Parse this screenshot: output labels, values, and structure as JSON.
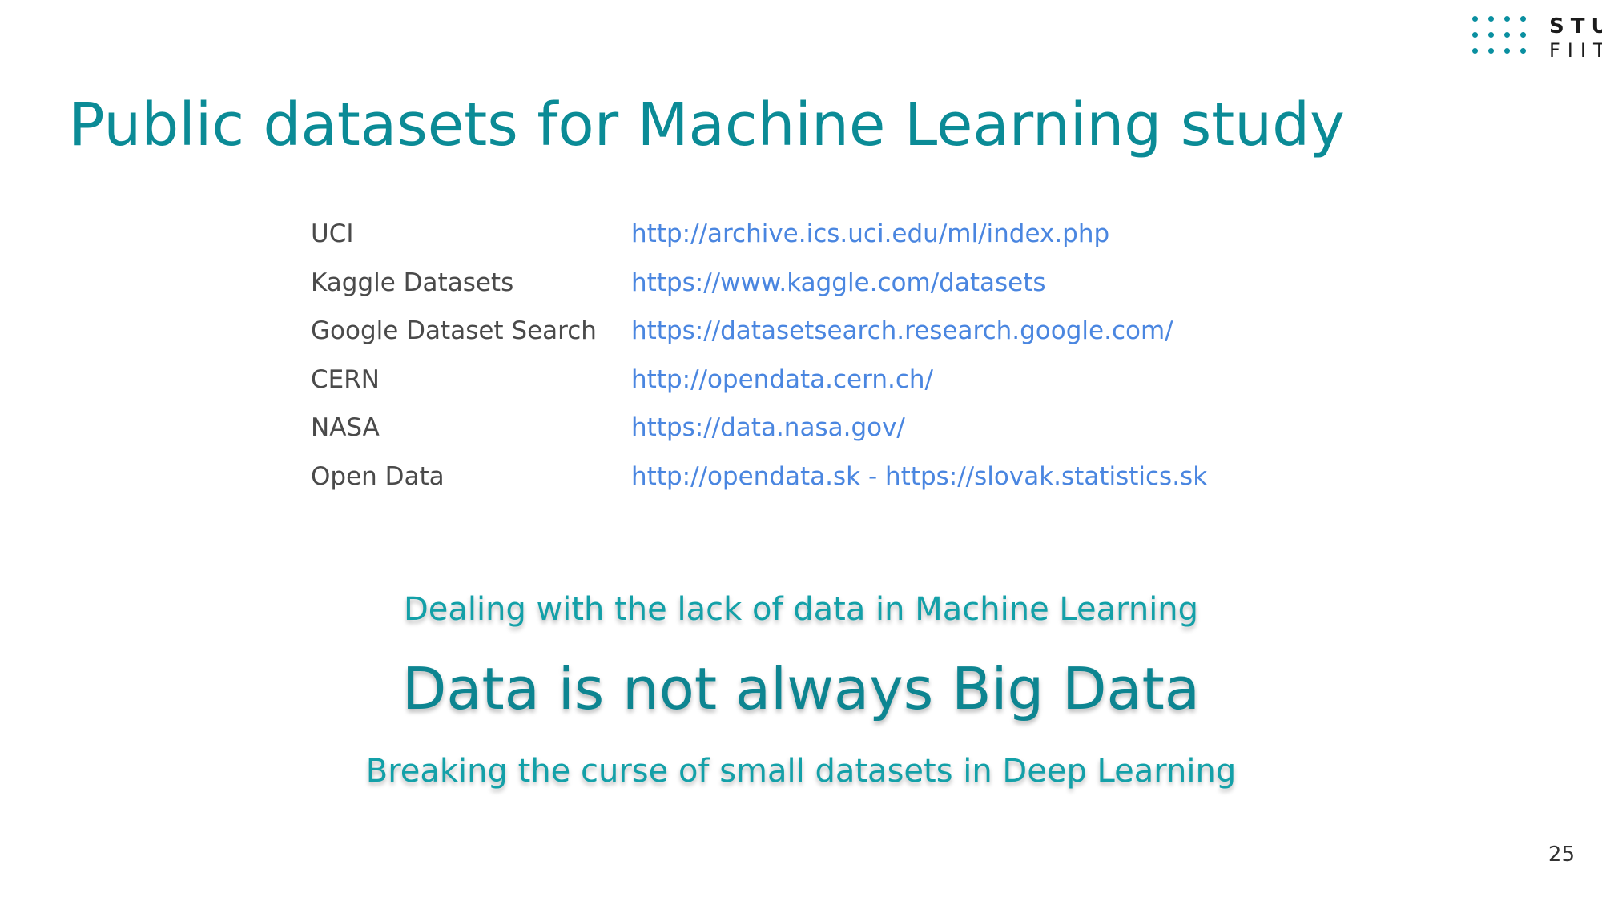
{
  "logo": {
    "line1": "STU",
    "line2": "FIIT"
  },
  "title": "Public datasets for Machine Learning study",
  "datasets": [
    {
      "name": "UCI",
      "url": "http://archive.ics.uci.edu/ml/index.php"
    },
    {
      "name": "Kaggle Datasets",
      "url": "https://www.kaggle.com/datasets"
    },
    {
      "name": "Google Dataset Search",
      "url": "https://datasetsearch.research.google.com/"
    },
    {
      "name": "CERN",
      "url": "http://opendata.cern.ch/"
    },
    {
      "name": "NASA",
      "url": "https://data.nasa.gov/"
    },
    {
      "name": "Open Data",
      "url": "http://opendata.sk - https://slovak.statistics.sk"
    }
  ],
  "headlines": {
    "sub1": "Dealing with the lack of data in Machine Learning",
    "big": "Data is not always Big Data",
    "sub2": "Breaking the curse of small datasets in Deep Learning"
  },
  "page_number": "25",
  "colors": {
    "title": "#0b8b96",
    "link": "#4a86e0",
    "accent": "#0a8fa0"
  }
}
